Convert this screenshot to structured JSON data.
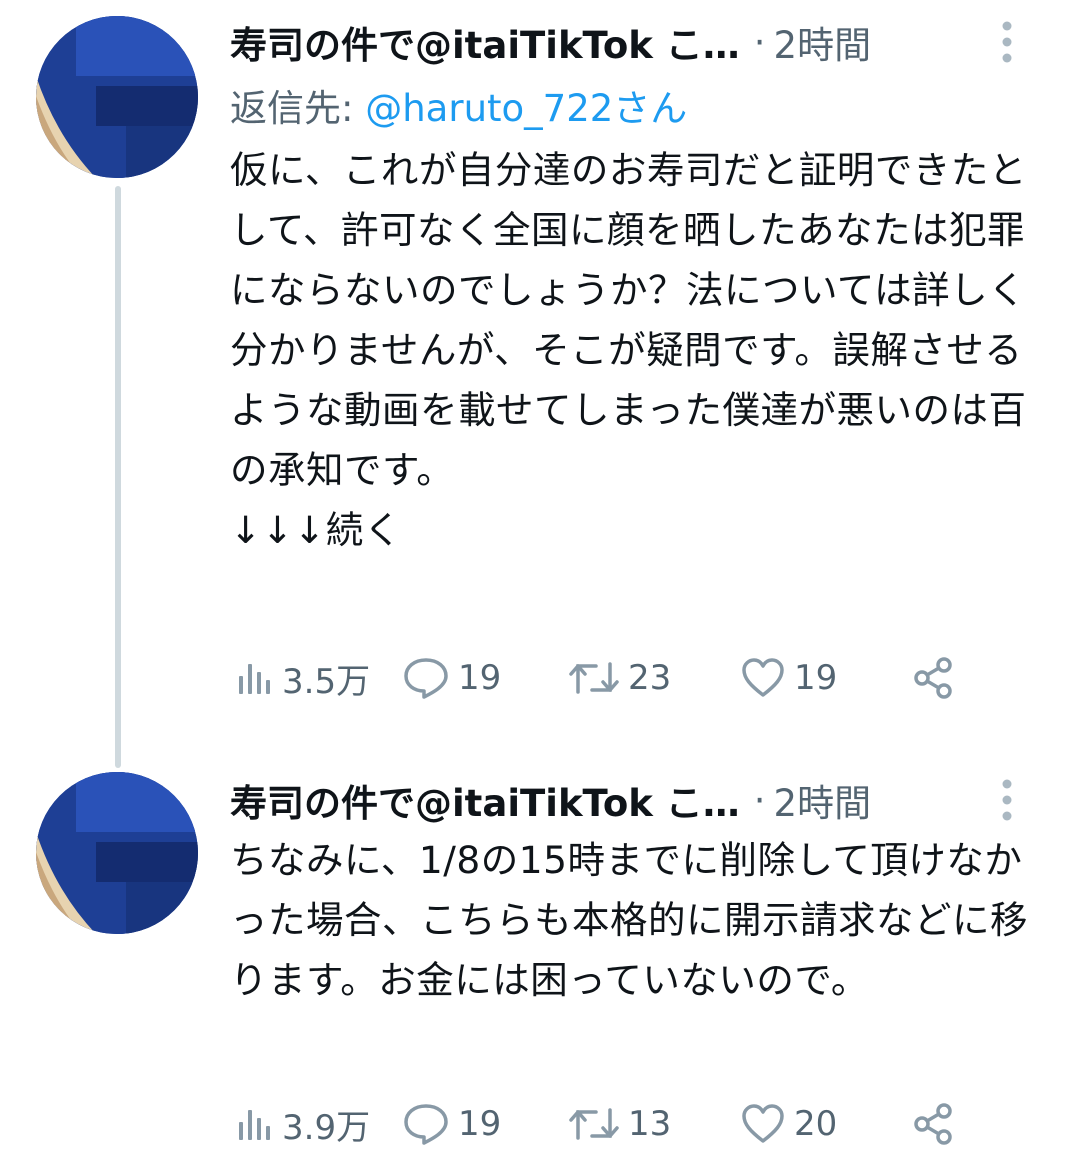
{
  "tweets": [
    {
      "display_name": "寿司の件で@itaiTikTok こ…",
      "separator": "·",
      "time": "2時間",
      "reply_label": "返信先: ",
      "reply_mention": "@haruto_722さん",
      "text": "仮に、これが自分達のお寿司だと証明できたとして、許可なく全国に顔を晒したあなたは犯罪にならないのでしょうか？法については詳しく分かりませんが、そこが疑問です。誤解させるような動画を載せてしまった僕達が悪いのは百の承知です。\n↓↓↓続く",
      "views": "3.5万",
      "replies": "19",
      "retweets": "23",
      "likes": "19"
    },
    {
      "display_name": "寿司の件で@itaiTikTok こ…",
      "separator": "·",
      "time": "2時間",
      "text": "ちなみに、1/8の15時までに削除して頂けなかった場合、こちらも本格的に開示請求などに移ります。お金には困っていないので。",
      "views": "3.9万",
      "replies": "19",
      "retweets": "13",
      "likes": "20"
    }
  ],
  "icons": {
    "more": "more-vertical-icon",
    "views": "analytics-icon",
    "reply": "comment-bubble-icon",
    "retweet": "retweet-icon",
    "like": "heart-icon",
    "share": "share-icon"
  },
  "colors": {
    "text": "#0f1419",
    "secondary": "#536471",
    "link": "#1d9bf0",
    "thread_line": "#cfd9de",
    "icon_gray": "#aab8c2"
  }
}
